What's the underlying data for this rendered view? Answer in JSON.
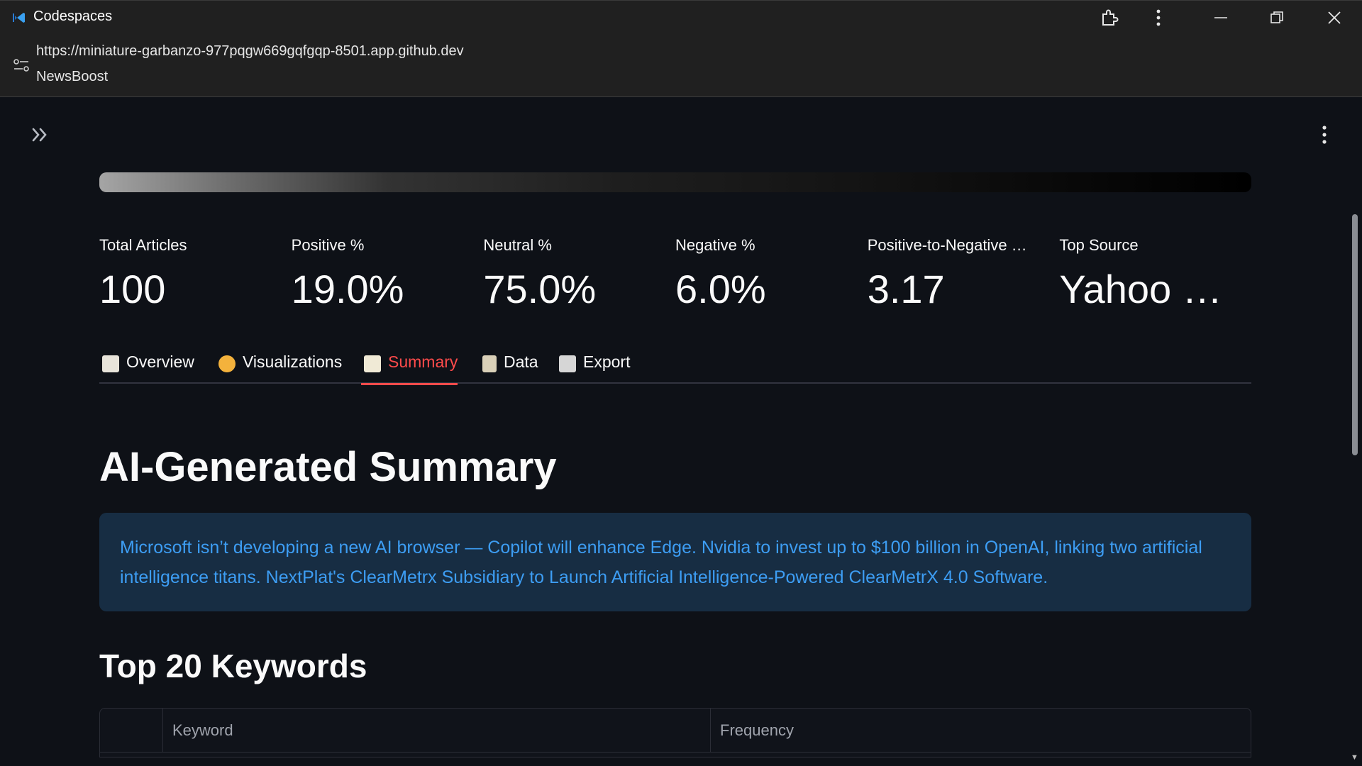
{
  "window": {
    "title": "Codespaces",
    "controls": [
      "extensions-icon",
      "more-vertical-icon",
      "minimize-icon",
      "restore-icon",
      "close-icon"
    ]
  },
  "address_bar": {
    "url": "https://miniature-garbanzo-977pqgw669gqfgqp-8501.app.github.dev",
    "page_title": "NewsBoost"
  },
  "metrics": [
    {
      "label": "Total Articles",
      "value": "100"
    },
    {
      "label": "Positive %",
      "value": "19.0%"
    },
    {
      "label": "Neutral %",
      "value": "75.0%"
    },
    {
      "label": "Negative %",
      "value": "6.0%"
    },
    {
      "label": "Positive-to-Negative Ratio",
      "value": "3.17"
    },
    {
      "label": "Top Source",
      "value": "Yahoo Finance"
    }
  ],
  "tabs": [
    {
      "label": "Overview",
      "icon": "ledger-icon",
      "color": "#e8e4da",
      "active": false
    },
    {
      "label": "Visualizations",
      "icon": "palette-icon",
      "color": "#f4b23c",
      "active": false
    },
    {
      "label": "Summary",
      "icon": "memo-icon",
      "color": "#f0ead6",
      "active": true
    },
    {
      "label": "Data",
      "icon": "clipboard-icon",
      "color": "#d9d0b8",
      "active": false
    },
    {
      "label": "Export",
      "icon": "floppy-disk-icon",
      "color": "#d6d6d6",
      "active": false
    }
  ],
  "summary": {
    "heading": "AI-Generated Summary",
    "text": "Microsoft isn’t developing a new AI browser — Copilot will enhance Edge. Nvidia to invest up to $100 billion in OpenAI, linking two artificial intelligence titans. NextPlat's ClearMetrx Subsidiary to Launch Artificial Intelligence-Powered ClearMetrX 4.0 Software."
  },
  "keywords": {
    "heading": "Top 20 Keywords",
    "columns": [
      "",
      "Keyword",
      "Frequency"
    ]
  },
  "colors": {
    "background": "#0e1117",
    "accent": "#ff4b4b",
    "info_bg": "#172d43",
    "info_text": "#3d9df3"
  }
}
